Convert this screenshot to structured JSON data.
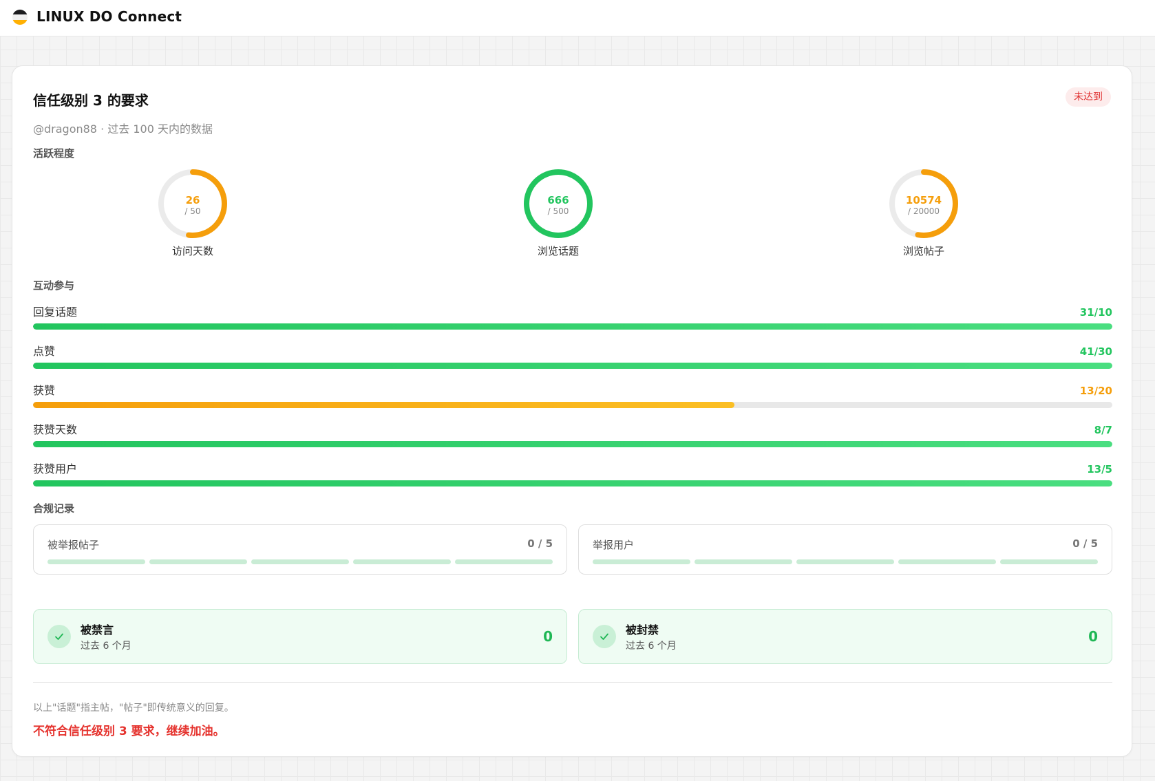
{
  "header": {
    "app_title": "LINUX DO Connect"
  },
  "card": {
    "title": "信任级别 3 的要求",
    "status_badge": "未达到",
    "subtitle": "@dragon88 · 过去 100 天内的数据"
  },
  "activity": {
    "label": "活跃程度",
    "rings": [
      {
        "label": "访问天数",
        "value": "26",
        "max": "/ 50",
        "progress": 0.52,
        "color": "#f59e0b"
      },
      {
        "label": "浏览话题",
        "value": "666",
        "max": "/ 500",
        "progress": 1.0,
        "color": "#22c55e"
      },
      {
        "label": "浏览帖子",
        "value": "10574",
        "max": "/ 20000",
        "progress": 0.5287,
        "color": "#f59e0b"
      }
    ]
  },
  "engagement": {
    "label": "互动参与",
    "bars": [
      {
        "name": "回复话题",
        "value": "31/10",
        "progress": 1.0,
        "color": "#22c55e"
      },
      {
        "name": "点赞",
        "value": "41/30",
        "progress": 1.0,
        "color": "#22c55e"
      },
      {
        "name": "获赞",
        "value": "13/20",
        "progress": 0.65,
        "color": "#f59e0b"
      },
      {
        "name": "获赞天数",
        "value": "8/7",
        "progress": 1.0,
        "color": "#22c55e"
      },
      {
        "name": "获赞用户",
        "value": "13/5",
        "progress": 1.0,
        "color": "#22c55e"
      }
    ]
  },
  "compliance": {
    "label": "合规记录",
    "boxes": [
      {
        "name": "被举报帖子",
        "value": "0 / 5"
      },
      {
        "name": "举报用户",
        "value": "0 / 5"
      }
    ],
    "status": [
      {
        "title": "被禁言",
        "sub": "过去 6 个月",
        "value": "0"
      },
      {
        "title": "被封禁",
        "sub": "过去 6 个月",
        "value": "0"
      }
    ]
  },
  "footer": {
    "note": "以上\"话题\"指主帖，\"帖子\"即传统意义的回复。",
    "verdict": "不符合信任级别 3 要求，继续加油。"
  },
  "colors": {
    "green": "#22c55e",
    "orange": "#f59e0b",
    "red": "#e5322d"
  }
}
